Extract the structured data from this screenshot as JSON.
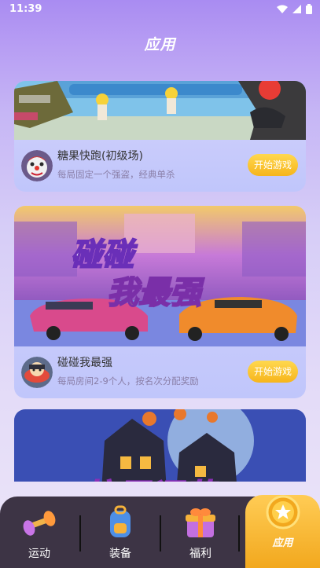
{
  "status_bar": {
    "time": "11:39"
  },
  "header": {
    "title": "应用"
  },
  "games": [
    {
      "name": "糖果快跑(初级场)",
      "desc": "每局固定一个强盗，经典单杀",
      "button": "开始游戏"
    },
    {
      "name": "碰碰我最强",
      "desc": "每局房间2-9个人，按名次分配奖励",
      "button": "开始游戏",
      "banner_title_1": "碰碰",
      "banner_title_2": "我最强"
    },
    {
      "banner_title": "搞恶逗萌"
    }
  ],
  "tabbar": {
    "items": [
      {
        "label": "运动",
        "icon": "dumbbell-icon"
      },
      {
        "label": "装备",
        "icon": "backpack-icon"
      },
      {
        "label": "福利",
        "icon": "gift-box-icon"
      },
      {
        "label": "应用",
        "icon": "star-badge-icon",
        "active": true
      }
    ]
  },
  "colors": {
    "accent": "#f6b51c",
    "tabbar_bg": "#3d3445",
    "header_bg": "#a98cf2"
  }
}
